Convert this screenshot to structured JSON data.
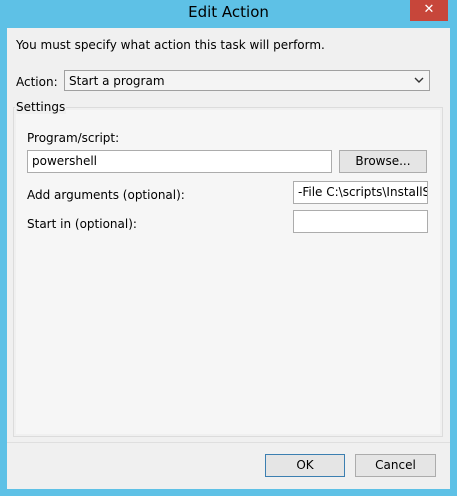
{
  "window": {
    "title": "Edit Action",
    "close_label": "✕"
  },
  "intro_text": "You must specify what action this task will perform.",
  "action": {
    "label": "Action:",
    "selected": "Start a program"
  },
  "settings": {
    "group_label": "Settings",
    "program_label": "Program/script:",
    "program_value": "powershell",
    "browse_label": "Browse...",
    "arguments_label": "Add arguments (optional):",
    "arguments_value": "-File C:\\scripts\\InstallSof",
    "start_in_label": "Start in (optional):",
    "start_in_value": ""
  },
  "buttons": {
    "ok": "OK",
    "cancel": "Cancel"
  },
  "colors": {
    "titlebar": "#5ec1e6",
    "close_button": "#c7463a",
    "dialog_background": "#f0f0f0"
  }
}
